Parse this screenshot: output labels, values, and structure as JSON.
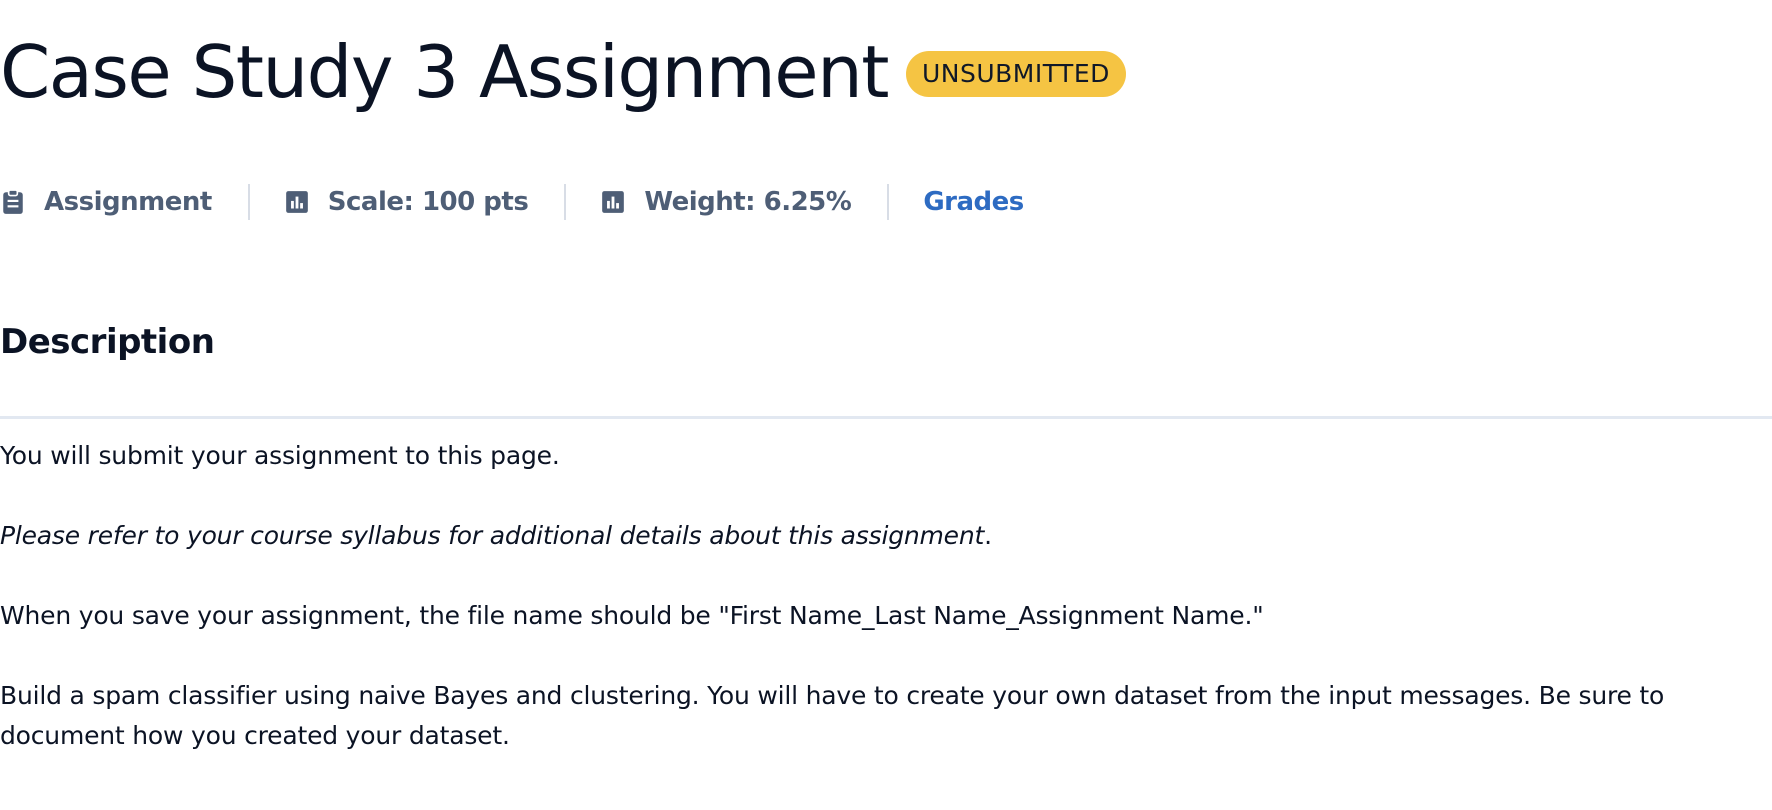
{
  "header": {
    "title": "Case Study 3 Assignment",
    "status_badge": "UNSUBMITTED"
  },
  "meta": {
    "type_label": "Assignment",
    "type_icon": "clipboard-icon",
    "scale_label": "Scale: 100 pts",
    "scale_icon": "bar-chart-icon",
    "weight_label": "Weight: 6.25%",
    "weight_icon": "bar-chart-icon",
    "grades_link": "Grades"
  },
  "description": {
    "heading": "Description",
    "paragraphs": {
      "p1": "You will submit your assignment to this page.",
      "p2_italic": "Please refer to your course syllabus for additional details about this assignment",
      "p2_end": ".",
      "p3": "When you save your assignment, the file name should be \"First Name_Last Name_Assignment Name.\"",
      "p4_line1": "Build a spam classifier using naive Bayes and clustering. You will have to create your own dataset from the input messages. Be sure to",
      "p4_line2": "document how you created your dataset."
    }
  },
  "colors": {
    "badge_bg": "#f5c443",
    "meta_text": "#4e5e76",
    "link": "#2d6bc2",
    "divider": "#e2e8f1"
  }
}
